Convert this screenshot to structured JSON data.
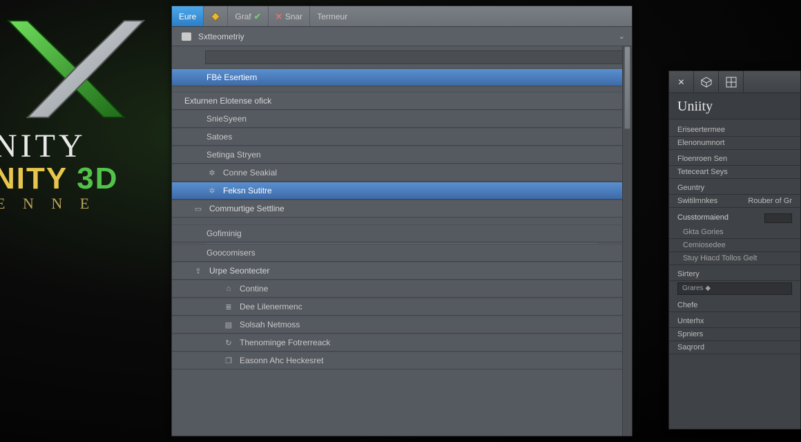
{
  "logo": {
    "line1": "NITY",
    "line2": "NITY",
    "line2_suffix": "3D",
    "line3": "E N N E"
  },
  "toolbar": {
    "eure": "Eure",
    "grad": "Graf",
    "snar": "Snar",
    "termeur": "Termeur"
  },
  "breadcrumb": {
    "value": "Sxtteometriy"
  },
  "search": {
    "value": ""
  },
  "mainList": {
    "selected1": "FBè Esertiern",
    "group1": "Exturnen Elotense ofick",
    "items1": [
      "SnieSyeen",
      "Satoes",
      "Setinga Stryen"
    ],
    "items_icons": [
      "Conne Seakial",
      "Feksn Sutitre"
    ],
    "group2": "Commurtige Settline",
    "items2": [
      "Gofiminig",
      "Goocomisers"
    ],
    "group3": "Urpe Seontecter",
    "sub3": [
      "Contine",
      "Dee Lilenermenc",
      "Solsah Netmoss",
      "Thenominge Fotrerreack",
      "Easonn Ahc Heckesret"
    ]
  },
  "inspector": {
    "title": "Uniity",
    "rows": [
      "Eriseertermee",
      "Elenonumnort"
    ],
    "rowsB": [
      "Floenroen Sen",
      "Teteceart Seys"
    ],
    "row_single": "Geuntry",
    "two": {
      "left": "Switilmnkes",
      "right": "Rouber of Gr"
    },
    "sectionC": [
      "Cusstormaiend",
      "Gkta Gories",
      "Cemiosedee",
      "Stuy Hiacd Tollos Gelt"
    ],
    "sectionD_label": "Sirtery",
    "sectionD_field": "Grares ◆",
    "sectionE": [
      "Chefe",
      "Unterhx",
      "Spniers",
      "Saqrord"
    ]
  }
}
